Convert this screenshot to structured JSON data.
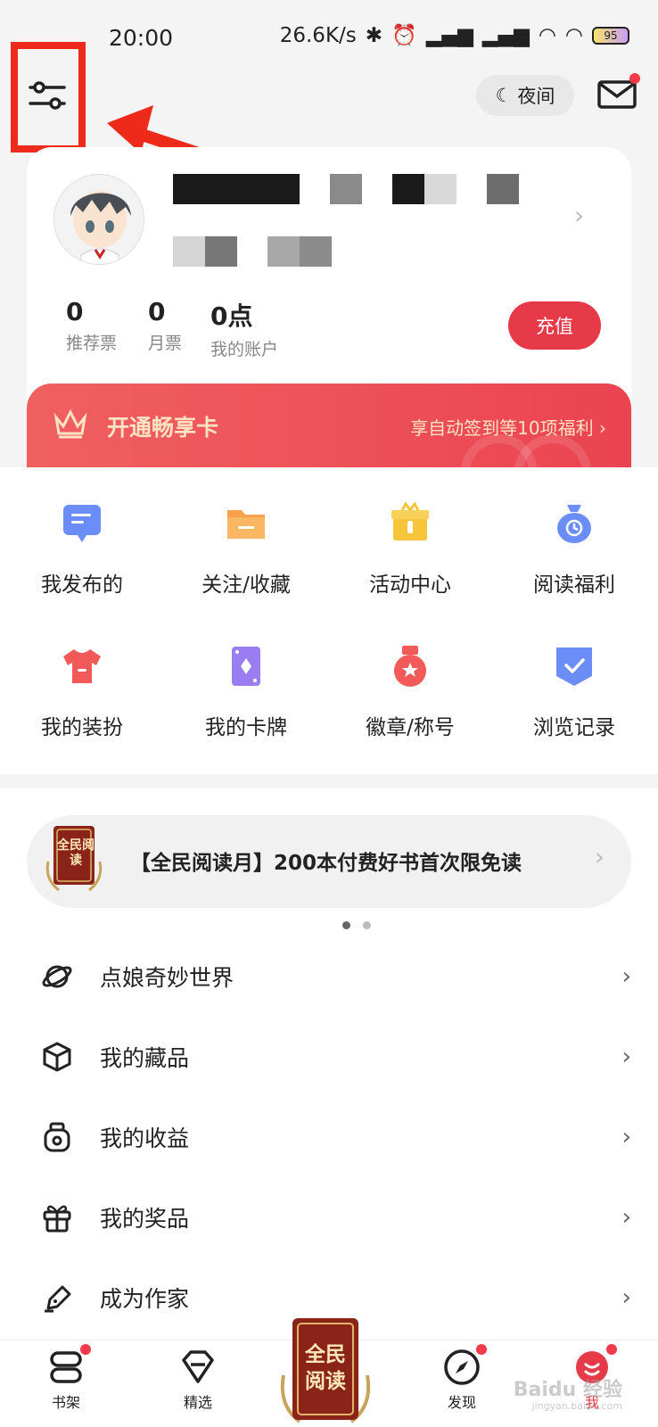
{
  "status_bar": {
    "time": "20:00",
    "network_speed": "26.6K/s",
    "battery": "95"
  },
  "header": {
    "night_mode_label": "夜间"
  },
  "profile": {
    "stats": [
      {
        "value": "0",
        "label": "推荐票"
      },
      {
        "value": "0",
        "label": "月票"
      },
      {
        "value": "0点",
        "label": "我的账户"
      }
    ],
    "recharge_label": "充值"
  },
  "vip": {
    "title": "开通畅享卡",
    "desc": "享自动签到等10项福利 ›"
  },
  "grid": [
    {
      "label": "我发布的",
      "icon": "message-icon",
      "color": "#6b8df7"
    },
    {
      "label": "关注/收藏",
      "icon": "folder-icon",
      "color": "#f7a14a"
    },
    {
      "label": "活动中心",
      "icon": "gift-icon",
      "color": "#f7c53a"
    },
    {
      "label": "阅读福利",
      "icon": "money-bag-icon",
      "color": "#6b8df7"
    },
    {
      "label": "我的装扮",
      "icon": "tshirt-icon",
      "color": "#f25a5a"
    },
    {
      "label": "我的卡牌",
      "icon": "card-icon",
      "color": "#9b7df2"
    },
    {
      "label": "徽章/称号",
      "icon": "medal-icon",
      "color": "#f25a5a"
    },
    {
      "label": "浏览记录",
      "icon": "history-icon",
      "color": "#6b8df7"
    }
  ],
  "promo": {
    "badge_text": "全民阅读",
    "text": "【全民阅读月】200本付费好书首次限免读"
  },
  "menu": [
    {
      "label": "点娘奇妙世界",
      "icon": "planet-icon"
    },
    {
      "label": "我的藏品",
      "icon": "cube-icon"
    },
    {
      "label": "我的收益",
      "icon": "wallet-icon"
    },
    {
      "label": "我的奖品",
      "icon": "prize-icon"
    },
    {
      "label": "成为作家",
      "icon": "pen-icon"
    }
  ],
  "tabs": [
    {
      "label": "书架",
      "icon": "bookshelf-icon"
    },
    {
      "label": "精选",
      "icon": "diamond-icon"
    },
    {
      "label": "发现",
      "icon": "compass-icon"
    },
    {
      "label": "我",
      "icon": "profile-icon"
    }
  ],
  "center_badge": "全民阅读",
  "watermark": {
    "text": "Baidu 经验",
    "sub": "jingyan.baidu.com"
  },
  "colors": {
    "accent": "#e63a48",
    "annotation": "#ee2a1a"
  }
}
